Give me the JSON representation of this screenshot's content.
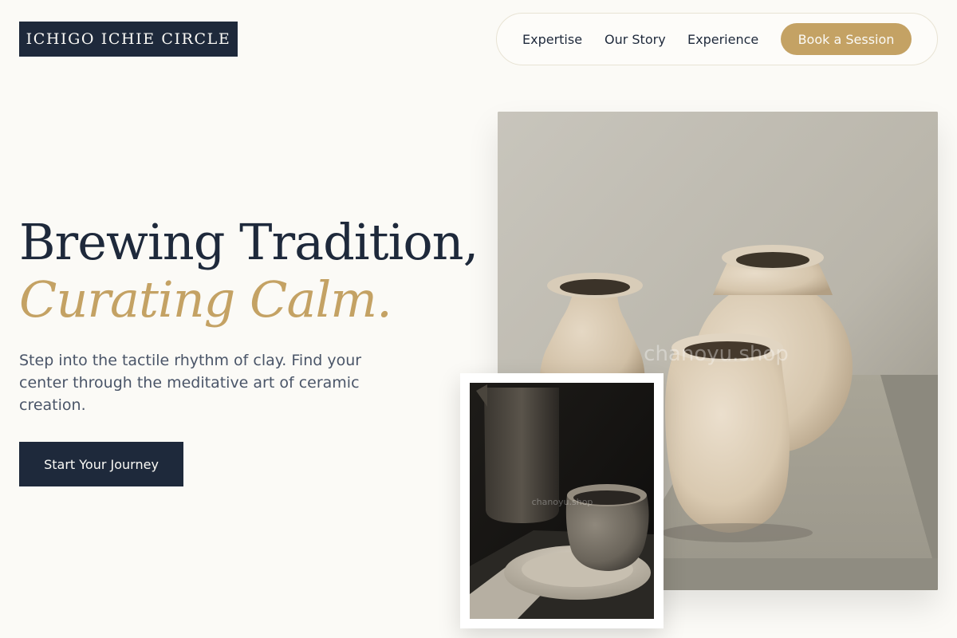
{
  "brand": {
    "logo_text": "ICHIGO ICHIE CIRCLE"
  },
  "nav": {
    "links": [
      {
        "label": "Expertise"
      },
      {
        "label": "Our Story"
      },
      {
        "label": "Experience"
      }
    ],
    "cta_label": "Book a Session"
  },
  "hero": {
    "headline_line1": "Brewing Tradition,",
    "headline_line2": "Curating Calm.",
    "subtext": "Step into the tactile rhythm of clay. Find your center through the meditative art of ceramic creation.",
    "cta_label": "Start Your Journey"
  },
  "images": {
    "main_watermark": "chanoyu.shop",
    "inset_watermark": "chanoyu.shop",
    "main_description_icon": "ceramic-vases-photo",
    "inset_description_icon": "ceramic-cup-plate-photo"
  },
  "colors": {
    "navy": "#1e293b",
    "gold": "#c4a264",
    "background": "#fbfaf6"
  }
}
